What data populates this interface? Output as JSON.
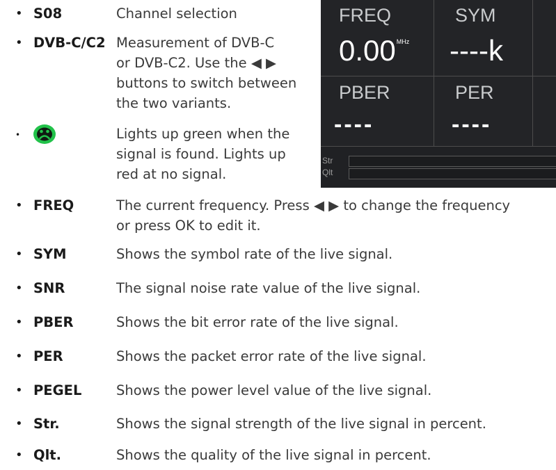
{
  "items_top": [
    {
      "bullet": "•",
      "term": "S08",
      "lines": [
        "Channel selection"
      ]
    },
    {
      "bullet": "•",
      "term": "DVB-C/C2",
      "lines": [
        "Measurement of DVB-C",
        "or DVB-C2. Use the ◀ ▶",
        "buttons to switch between",
        "the two variants."
      ]
    },
    {
      "bullet": "•",
      "icon": "signal-face-icon",
      "lines": [
        "Lights up green when the",
        "signal is found. Lights up",
        "red at no signal."
      ]
    }
  ],
  "items_bottom": [
    {
      "bullet": "•",
      "term": "FREQ",
      "lines": [
        "The current frequency. Press ◀ ▶ to change the frequency",
        "or press OK to edit it."
      ]
    },
    {
      "bullet": "•",
      "term": "SYM",
      "lines": [
        "Shows the symbol rate of the live signal."
      ]
    },
    {
      "bullet": "•",
      "term": "SNR",
      "lines": [
        "The signal noise rate value of the live signal."
      ]
    },
    {
      "bullet": "•",
      "term": "PBER",
      "lines": [
        "Shows the bit error rate of the live signal."
      ]
    },
    {
      "bullet": "•",
      "term": "PER",
      "lines": [
        "Shows the packet error rate of the live signal."
      ]
    },
    {
      "bullet": "•",
      "term": "PEGEL",
      "lines": [
        "Shows the power level value of the live signal."
      ]
    },
    {
      "bullet": "•",
      "term": "Str.",
      "lines": [
        "Shows the signal strength of the live signal in percent."
      ]
    },
    {
      "bullet": "•",
      "term": "Qlt.",
      "lines": [
        "Shows the quality of the live signal in percent."
      ]
    }
  ],
  "screen": {
    "freq_label": "FREQ",
    "freq_value": "0.00",
    "freq_unit": "MHz",
    "sym_label": "SYM",
    "sym_value": "----k",
    "pber_label": "PBER",
    "pber_value": "----",
    "per_label": "PER",
    "per_value": "----",
    "str_label": "Str",
    "qlt_label": "Qlt"
  },
  "colors": {
    "icon_green": "#22c24a",
    "accent_orange": "#f39a1e"
  }
}
